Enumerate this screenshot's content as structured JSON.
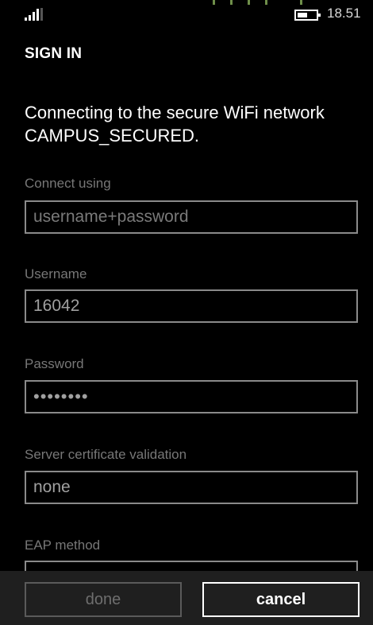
{
  "status_bar": {
    "time": "18.51",
    "signal_icon": "signal-strength-icon",
    "battery_icon": "battery-icon"
  },
  "page": {
    "title": "SIGN IN",
    "intro": "Connecting to the secure WiFi network CAMPUS_SECURED."
  },
  "fields": {
    "connect_using": {
      "label": "Connect using",
      "value": "username+password"
    },
    "username": {
      "label": "Username",
      "value": "16042"
    },
    "password": {
      "label": "Password",
      "value": "••••••••"
    },
    "server_cert": {
      "label": "Server certificate validation",
      "value": "none"
    },
    "eap_method": {
      "label": "EAP method",
      "value": ""
    }
  },
  "app_bar": {
    "done_label": "done",
    "cancel_label": "cancel"
  },
  "colors": {
    "background": "#000000",
    "label": "#777777",
    "field_border": "#8a8a8a",
    "app_bar": "#1f1f1f"
  }
}
